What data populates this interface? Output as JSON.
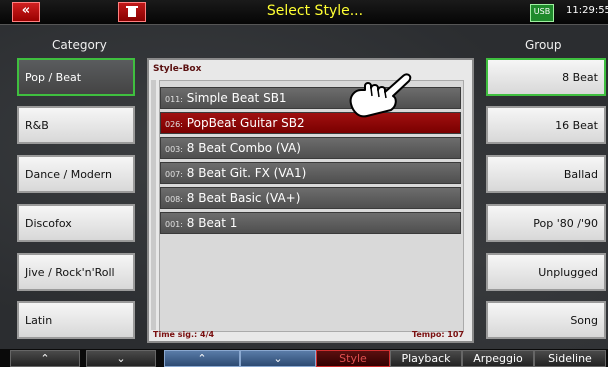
{
  "topbar": {
    "back_label": "«",
    "title": "Select Style...",
    "usb_label": "USB",
    "clock": "11:29:55"
  },
  "headers": {
    "category": "Category",
    "group": "Group"
  },
  "categories": [
    {
      "label": "Pop / Beat",
      "active": true
    },
    {
      "label": "R&B"
    },
    {
      "label": "Dance / Modern"
    },
    {
      "label": "Discofox"
    },
    {
      "label": "Jive / Rock'n'Roll"
    },
    {
      "label": "Latin"
    }
  ],
  "groups": [
    {
      "label": "8 Beat",
      "active": true
    },
    {
      "label": "16 Beat"
    },
    {
      "label": "Ballad"
    },
    {
      "label": "Pop '80 /'90"
    },
    {
      "label": "Unplugged"
    },
    {
      "label": "Song"
    }
  ],
  "stylebox": {
    "title": "Style-Box",
    "time_sig": "Time sig.: 4/4",
    "tempo": "Tempo: 107",
    "styles": [
      {
        "num": "011:",
        "name": "Simple Beat SB1"
      },
      {
        "num": "026:",
        "name": "PopBeat Guitar SB2",
        "selected": true
      },
      {
        "num": "003:",
        "name": "8 Beat Combo (VA)"
      },
      {
        "num": "007:",
        "name": "8 Beat Git. FX (VA1)"
      },
      {
        "num": "008:",
        "name": "8 Beat Basic (VA+)"
      },
      {
        "num": "001:",
        "name": "8 Beat 1"
      }
    ]
  },
  "bottom": {
    "up1": "⌃",
    "down1": "⌄",
    "up2": "⌃",
    "down2": "⌄",
    "style": "Style",
    "playback": "Playback",
    "arpeggio": "Arpeggio",
    "sideline": "Sideline"
  },
  "icons": [
    "back-icon",
    "trash-icon",
    "usb-icon",
    "hand-pointer-icon"
  ]
}
